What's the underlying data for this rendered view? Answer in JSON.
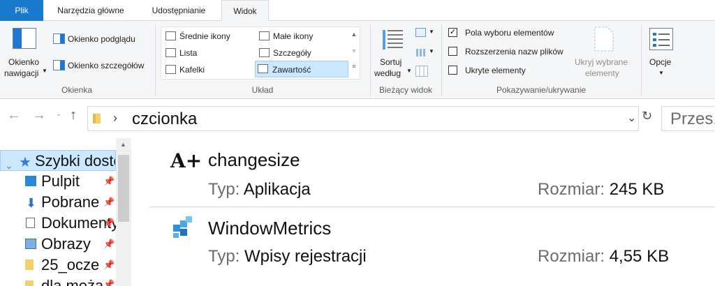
{
  "tabs": {
    "file": "Plik",
    "home": "Narzędzia główne",
    "share": "Udostępnianie",
    "view": "Widok"
  },
  "ribbon": {
    "panes": {
      "nav_pane_line1": "Okienko",
      "nav_pane_line2": "nawigacji",
      "preview_pane": "Okienko podglądu",
      "details_pane": "Okienko szczegółów",
      "label": "Okienka"
    },
    "layout": {
      "medium_icons": "Średnie ikony",
      "small_icons": "Małe ikony",
      "list": "Lista",
      "details": "Szczegóły",
      "tiles": "Kafelki",
      "content": "Zawartość",
      "label": "Układ"
    },
    "current_view": {
      "sort_line1": "Sortuj",
      "sort_line2": "według",
      "label": "Bieżący widok"
    },
    "show_hide": {
      "item_checkboxes": "Pola wyboru elementów",
      "item_checkboxes_checked": true,
      "file_extensions": "Rozszerzenia nazw plików",
      "hidden_items": "Ukryte elementy",
      "hide_selected_line1": "Ukryj wybrane",
      "hide_selected_line2": "elementy",
      "label": "Pokazywanie/ukrywanie"
    },
    "options": "Opcje"
  },
  "address": {
    "path": "czcionka",
    "search_placeholder": "Przes."
  },
  "nav_pane": {
    "items": [
      {
        "label": "Szybki dostęp"
      },
      {
        "label": "Pulpit"
      },
      {
        "label": "Pobrane"
      },
      {
        "label": "Dokumenty"
      },
      {
        "label": "Obrazy"
      },
      {
        "label": "25_ocze"
      },
      {
        "label": "dla meża"
      }
    ]
  },
  "files": [
    {
      "name": "changesize",
      "type_label": "Typ:",
      "type": "Aplikacja",
      "size_label": "Rozmiar:",
      "size": "245 KB"
    },
    {
      "name": "WindowMetrics",
      "type_label": "Typ:",
      "type": "Wpisy rejestracji",
      "size_label": "Rozmiar:",
      "size": "4,55 KB"
    }
  ],
  "colors": {
    "file_tab": "#1979ca",
    "selection": "#cce8ff",
    "selection_border": "#99d1ff"
  }
}
